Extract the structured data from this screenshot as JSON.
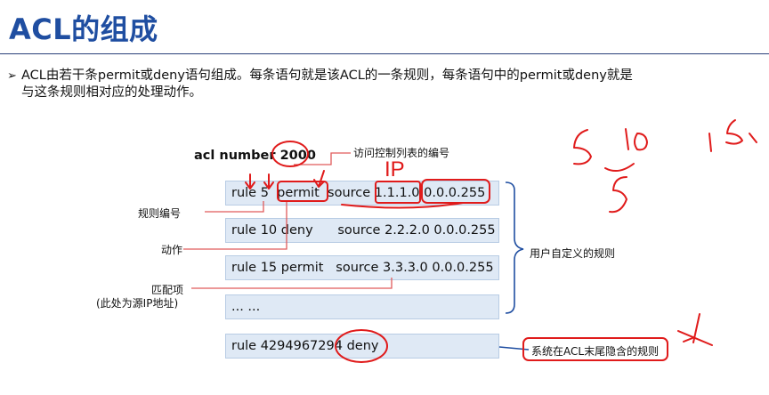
{
  "slide": {
    "title": "ACL的组成",
    "bullet_arrow": "➢",
    "bullet_line1": "ACL由若干条permit或deny语句组成。每条语句就是该ACL的一条规则，每条语句中的permit或deny就是",
    "bullet_line2": "与这条规则相对应的处理动作。"
  },
  "acl": {
    "header": "acl number 2000",
    "rules": [
      "rule 5  permit  source 1.1.1.0 0.0.0.255",
      "rule 10 deny      source 2.2.2.0 0.0.0.255",
      "rule 15 permit   source 3.3.3.0 0.0.0.255",
      "... ...",
      "rule 4294967294 deny"
    ]
  },
  "annotations": {
    "acl_number": "访问控制列表的编号",
    "rule_number": "规则编号",
    "action": "动作",
    "match_item": "匹配项",
    "match_item_note": "(此处为源IP地址)",
    "user_defined": "用户自定义的规则",
    "implicit_rule": "系统在ACL末尾隐含的规则"
  },
  "handwriting": {
    "ip_label": "IP"
  },
  "colors": {
    "title": "#1f4ea1",
    "box_fill": "#dfe9f5",
    "callout_line": "#e05a5a",
    "ink": "#e01b1b",
    "bracket": "#1f4ea1"
  }
}
